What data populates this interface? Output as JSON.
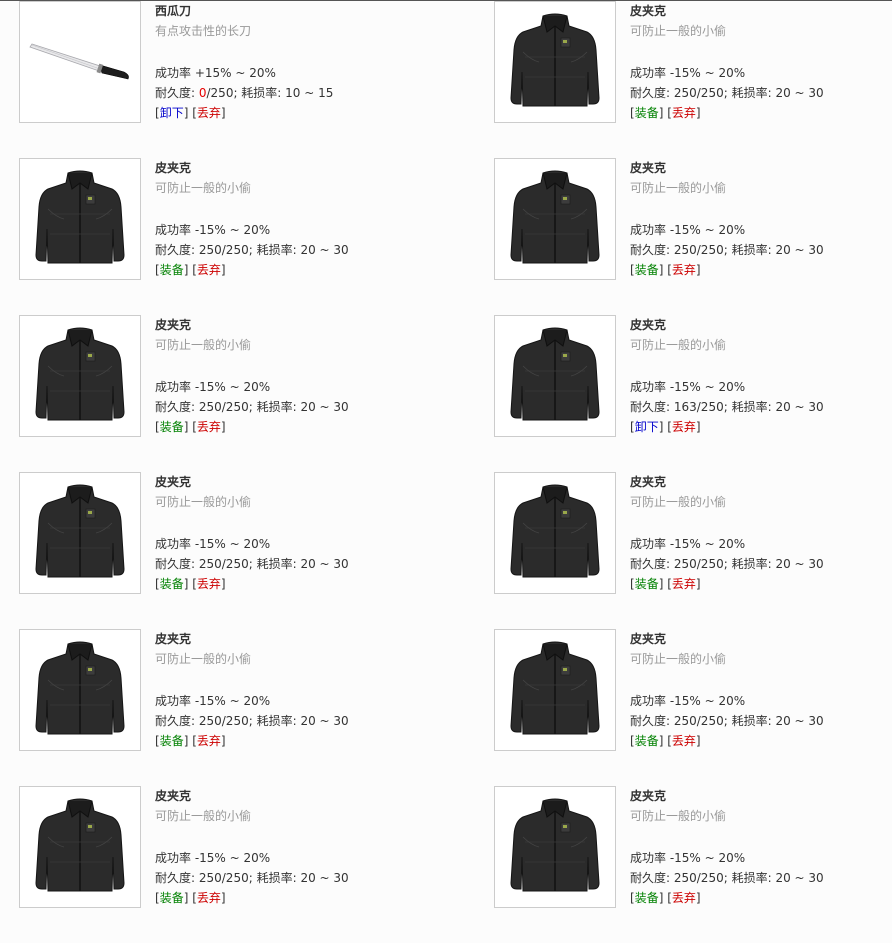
{
  "labels": {
    "success_prefix": "成功率 ",
    "durability_prefix": "耐久度: ",
    "wear_prefix": "; 耗损率: ",
    "open_bracket": "[",
    "close_bracket": "]"
  },
  "items": [
    {
      "name": "西瓜刀",
      "desc": "有点攻击性的长刀",
      "icon": "knife",
      "success": "+15% ~ 20%",
      "dur_cur": "0",
      "dur_cur_red": true,
      "dur_max": "/250",
      "wear": "10 ~ 15",
      "action": "卸下",
      "action_type": "unequip",
      "drop": "丢弃"
    },
    {
      "name": "皮夹克",
      "desc": "可防止一般的小偷",
      "icon": "jacket",
      "success": "-15% ~ 20%",
      "dur_cur": "250",
      "dur_cur_red": false,
      "dur_max": "/250",
      "wear": "20 ~ 30",
      "action": "装备",
      "action_type": "equip",
      "drop": "丢弃"
    },
    {
      "name": "皮夹克",
      "desc": "可防止一般的小偷",
      "icon": "jacket",
      "success": "-15% ~ 20%",
      "dur_cur": "250",
      "dur_cur_red": false,
      "dur_max": "/250",
      "wear": "20 ~ 30",
      "action": "装备",
      "action_type": "equip",
      "drop": "丢弃"
    },
    {
      "name": "皮夹克",
      "desc": "可防止一般的小偷",
      "icon": "jacket",
      "success": "-15% ~ 20%",
      "dur_cur": "250",
      "dur_cur_red": false,
      "dur_max": "/250",
      "wear": "20 ~ 30",
      "action": "装备",
      "action_type": "equip",
      "drop": "丢弃"
    },
    {
      "name": "皮夹克",
      "desc": "可防止一般的小偷",
      "icon": "jacket",
      "success": "-15% ~ 20%",
      "dur_cur": "250",
      "dur_cur_red": false,
      "dur_max": "/250",
      "wear": "20 ~ 30",
      "action": "装备",
      "action_type": "equip",
      "drop": "丢弃"
    },
    {
      "name": "皮夹克",
      "desc": "可防止一般的小偷",
      "icon": "jacket",
      "success": "-15% ~ 20%",
      "dur_cur": "163",
      "dur_cur_red": false,
      "dur_max": "/250",
      "wear": "20 ~ 30",
      "action": "卸下",
      "action_type": "unequip",
      "drop": "丢弃"
    },
    {
      "name": "皮夹克",
      "desc": "可防止一般的小偷",
      "icon": "jacket",
      "success": "-15% ~ 20%",
      "dur_cur": "250",
      "dur_cur_red": false,
      "dur_max": "/250",
      "wear": "20 ~ 30",
      "action": "装备",
      "action_type": "equip",
      "drop": "丢弃"
    },
    {
      "name": "皮夹克",
      "desc": "可防止一般的小偷",
      "icon": "jacket",
      "success": "-15% ~ 20%",
      "dur_cur": "250",
      "dur_cur_red": false,
      "dur_max": "/250",
      "wear": "20 ~ 30",
      "action": "装备",
      "action_type": "equip",
      "drop": "丢弃"
    },
    {
      "name": "皮夹克",
      "desc": "可防止一般的小偷",
      "icon": "jacket",
      "success": "-15% ~ 20%",
      "dur_cur": "250",
      "dur_cur_red": false,
      "dur_max": "/250",
      "wear": "20 ~ 30",
      "action": "装备",
      "action_type": "equip",
      "drop": "丢弃"
    },
    {
      "name": "皮夹克",
      "desc": "可防止一般的小偷",
      "icon": "jacket",
      "success": "-15% ~ 20%",
      "dur_cur": "250",
      "dur_cur_red": false,
      "dur_max": "/250",
      "wear": "20 ~ 30",
      "action": "装备",
      "action_type": "equip",
      "drop": "丢弃"
    },
    {
      "name": "皮夹克",
      "desc": "可防止一般的小偷",
      "icon": "jacket",
      "success": "-15% ~ 20%",
      "dur_cur": "250",
      "dur_cur_red": false,
      "dur_max": "/250",
      "wear": "20 ~ 30",
      "action": "装备",
      "action_type": "equip",
      "drop": "丢弃"
    },
    {
      "name": "皮夹克",
      "desc": "可防止一般的小偷",
      "icon": "jacket",
      "success": "-15% ~ 20%",
      "dur_cur": "250",
      "dur_cur_red": false,
      "dur_max": "/250",
      "wear": "20 ~ 30",
      "action": "装备",
      "action_type": "equip",
      "drop": "丢弃"
    }
  ],
  "colors": {
    "equip": "#008000",
    "unequip": "#0000cc",
    "drop": "#cc0000",
    "zero_durability": "#e60000"
  }
}
